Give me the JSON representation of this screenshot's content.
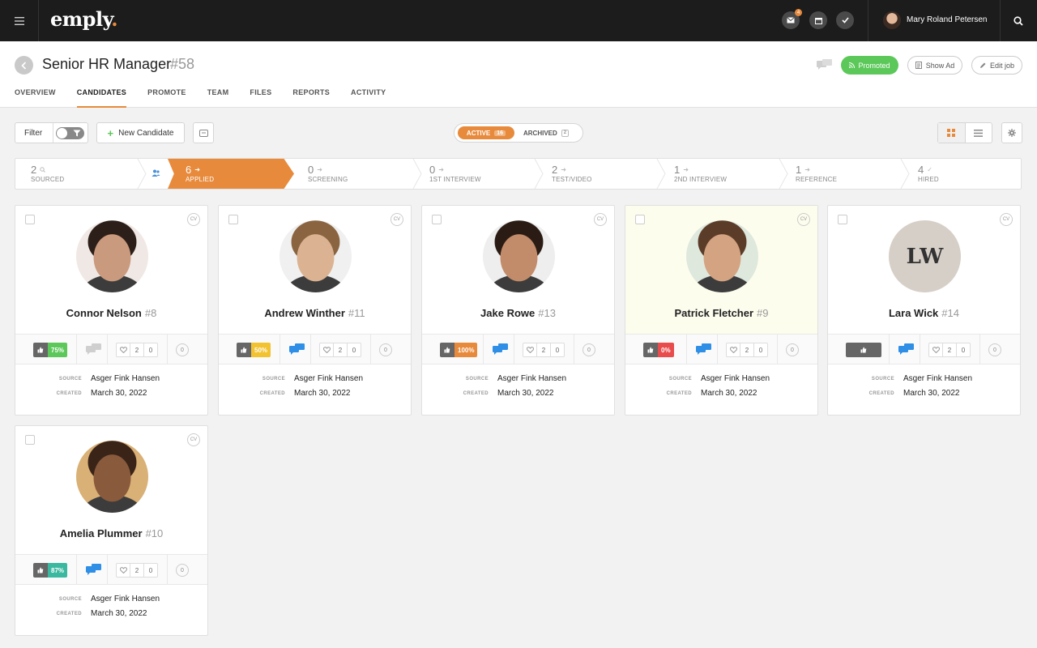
{
  "topbar": {
    "logo": "emply",
    "logo_dot": ".",
    "mail_badge": "4",
    "user_name": "Mary Roland Petersen"
  },
  "header": {
    "job_title": "Senior HR Manager",
    "job_number": "#58",
    "promoted_label": "Promoted",
    "show_ad_label": "Show Ad",
    "edit_job_label": "Edit job",
    "tabs": [
      "OVERVIEW",
      "CANDIDATES",
      "PROMOTE",
      "TEAM",
      "FILES",
      "REPORTS",
      "ACTIVITY"
    ],
    "active_tab": "CANDIDATES"
  },
  "toolbar": {
    "filter_label": "Filter",
    "new_candidate_label": "New Candidate",
    "active_label": "ACTIVE",
    "active_count": "16",
    "archived_label": "ARCHIVED",
    "archived_count": "2"
  },
  "pipeline": [
    {
      "count": "2",
      "label": "SOURCED"
    },
    {
      "count": "6",
      "label": "APPLIED",
      "active": true
    },
    {
      "count": "0",
      "label": "SCREENING"
    },
    {
      "count": "0",
      "label": "1ST INTERVIEW"
    },
    {
      "count": "2",
      "label": "TEST/VIDEO"
    },
    {
      "count": "1",
      "label": "2ND INTERVIEW"
    },
    {
      "count": "1",
      "label": "REFERENCE"
    },
    {
      "count": "4",
      "label": "HIRED"
    }
  ],
  "card_labels": {
    "cv": "CV",
    "source_label": "SOURCE",
    "created_label": "CREATED"
  },
  "candidates": [
    {
      "name": "Connor Nelson",
      "number": "#8",
      "score": "75%",
      "score_color": "#5cc85a",
      "likes": "2",
      "dislikes": "0",
      "comments": "0",
      "source": "Asger Fink Hansen",
      "created": "March 30, 2022",
      "comment_active": false,
      "highlighted": false
    },
    {
      "name": "Andrew Winther",
      "number": "#11",
      "score": "50%",
      "score_color": "#f2c230",
      "likes": "2",
      "dislikes": "0",
      "comments": "0",
      "source": "Asger Fink Hansen",
      "created": "March 30, 2022",
      "comment_active": true,
      "highlighted": false
    },
    {
      "name": "Jake Rowe",
      "number": "#13",
      "score": "100%",
      "score_color": "#e88a3c",
      "likes": "2",
      "dislikes": "0",
      "comments": "0",
      "source": "Asger Fink Hansen",
      "created": "March 30, 2022",
      "comment_active": true,
      "highlighted": false
    },
    {
      "name": "Patrick Fletcher",
      "number": "#9",
      "score": "0%",
      "score_color": "#e84c4c",
      "likes": "2",
      "dislikes": "0",
      "comments": "0",
      "source": "Asger Fink Hansen",
      "created": "March 30, 2022",
      "comment_active": true,
      "highlighted": true
    },
    {
      "name": "Lara Wick",
      "number": "#14",
      "initials": "LW",
      "score": "",
      "score_color": "#666666",
      "likes": "2",
      "dislikes": "0",
      "comments": "0",
      "source": "Asger Fink Hansen",
      "created": "March 30, 2022",
      "comment_active": true,
      "highlighted": false
    },
    {
      "name": "Amelia Plummer",
      "number": "#10",
      "score": "87%",
      "score_color": "#3bb8a0",
      "likes": "2",
      "dislikes": "0",
      "comments": "0",
      "source": "Asger Fink Hansen",
      "created": "March 30, 2022",
      "comment_active": true,
      "highlighted": false
    }
  ]
}
